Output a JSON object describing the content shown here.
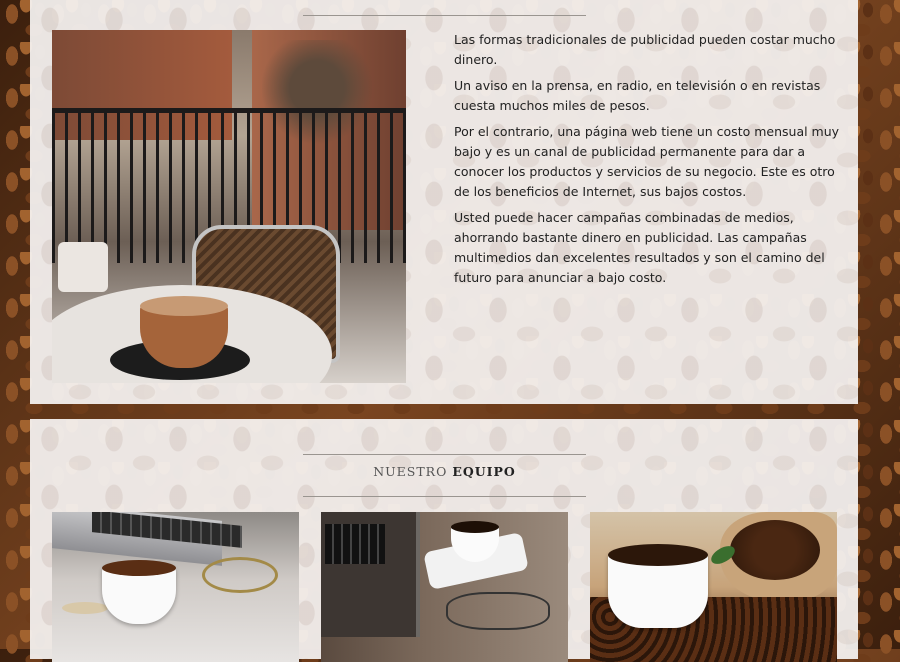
{
  "about": {
    "paragraphs": [
      "Las formas tradicionales de publicidad pueden costar mucho dinero.",
      "Un aviso en la prensa, en radio, en televisión o en revistas cuesta muchos miles de pesos.",
      "Por el contrario, una página web tiene un costo mensual muy bajo y es un canal de publicidad permanente para dar a conocer los productos y servicios de su negocio. Este es otro de los beneficios de Internet, sus bajos costos.",
      "Usted puede hacer campañas combinadas de medios, ahorrando bastante dinero en publicidad. Las campañas multimedios dan excelentes resultados y son el camino del futuro para anunciar a bajo costo."
    ]
  },
  "team": {
    "title_light": "Nuestro",
    "title_bold": "Equipo"
  }
}
